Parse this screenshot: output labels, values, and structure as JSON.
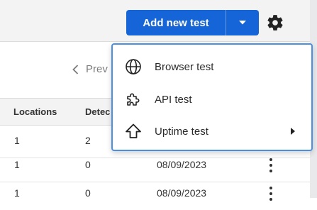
{
  "header": {
    "add_button_label": "Add new test"
  },
  "pager": {
    "prev_label": "Prev"
  },
  "table": {
    "columns": [
      "Locations",
      "Detec"
    ],
    "rows": [
      {
        "locations": "1",
        "detections": "2",
        "date": ""
      },
      {
        "locations": "1",
        "detections": "0",
        "date": "08/09/2023"
      },
      {
        "locations": "1",
        "detections": "0",
        "date": "08/09/2023"
      }
    ]
  },
  "menu": {
    "items": [
      {
        "label": "Browser test",
        "icon": "globe-icon"
      },
      {
        "label": "API test",
        "icon": "puzzle-icon"
      },
      {
        "label": "Uptime test",
        "icon": "arrow-up-icon",
        "has_submenu": true
      }
    ]
  },
  "colors": {
    "primary": "#1565d8",
    "menu_border": "#4a8fe2"
  }
}
